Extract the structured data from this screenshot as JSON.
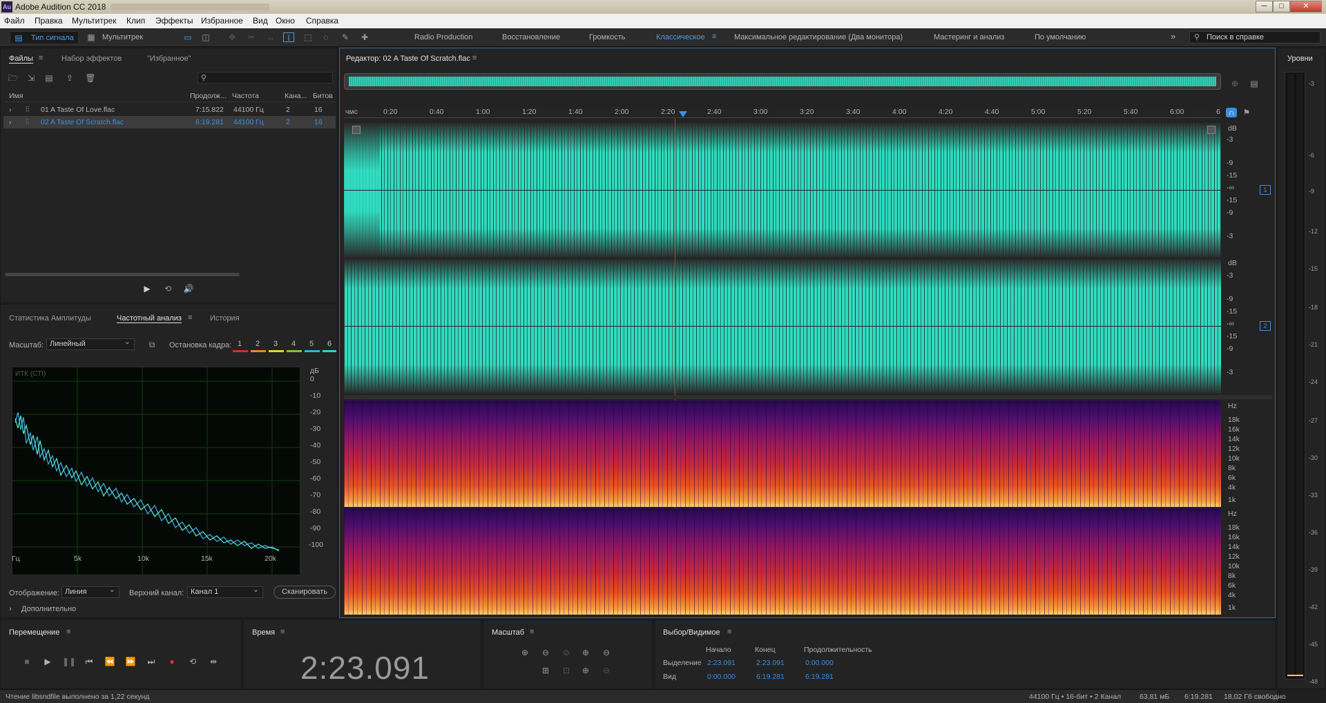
{
  "titlebar": {
    "app_icon": "Au",
    "title": "Adobe Audition CC 2018",
    "min": "─",
    "max": "□",
    "close": "✕"
  },
  "menu": [
    "Файл",
    "Правка",
    "Мультитрек",
    "Клип",
    "Эффекты",
    "Избранное",
    "Вид",
    "Окно",
    "Справка"
  ],
  "toolbar": {
    "waveform_mode": "Тип сигнала",
    "multitrack_mode": "Мультитрек",
    "workspaces": [
      "Radio Production",
      "Восстановление",
      "Громкость",
      "Классическое",
      "Максимальное редактирование (Два монитора)",
      "Мастеринг и анализ",
      "По умолчанию"
    ],
    "active_workspace": "Классическое",
    "more": "»",
    "help_placeholder": "Поиск в справке"
  },
  "files_panel": {
    "tabs": [
      "Файлы",
      "Набор эффектов",
      "\"Избранное\""
    ],
    "columns": [
      "Имя",
      "Продолж...",
      "Частота",
      "Кана...",
      "Битов"
    ],
    "search_placeholder": "",
    "rows": [
      {
        "name": "01 A Taste Of Love.flac",
        "duration": "7:15.822",
        "rate": "44100 Гц",
        "channels": "2",
        "bits": "16"
      },
      {
        "name": "02 A Taste Of Scratch.flac",
        "duration": "6:19.281",
        "rate": "44100 Гц",
        "channels": "2",
        "bits": "16"
      }
    ]
  },
  "analysis_panel": {
    "tabs": [
      "Статистика Амплитуды",
      "Частотный анализ",
      "История"
    ],
    "scale_label": "Масштаб:",
    "scale_value": "Линейный",
    "freeze_label": "Остановка кадра:",
    "freeze_buttons": [
      "1",
      "2",
      "3",
      "4",
      "5",
      "6"
    ],
    "freeze_colors": [
      "#d0312d",
      "#e8882a",
      "#e6d32a",
      "#7dc63a",
      "#3ab0e0",
      "#2ad0d0"
    ],
    "graph_label": "ИТК (СТI)",
    "db_unit": "дБ",
    "db_ticks": [
      "0",
      "-10",
      "-20",
      "-30",
      "-40",
      "-50",
      "-60",
      "-70",
      "-80",
      "-90",
      "-100"
    ],
    "freq_ticks": [
      "Гц",
      "5k",
      "10k",
      "15k",
      "20k"
    ],
    "display_label": "Отображение:",
    "display_value": "Линия",
    "channel_label": "Верхний канал:",
    "channel_value": "Канал 1",
    "scan_button": "Сканировать",
    "more": "Дополнительно"
  },
  "editor": {
    "tab": "Редактор: 02 A Taste Of Scratch.flac",
    "ruler_unit": "чмс",
    "ruler": [
      "0:20",
      "0:40",
      "1:00",
      "1:20",
      "1:40",
      "2:00",
      "2:20",
      "2:40",
      "3:00",
      "3:20",
      "3:40",
      "4:00",
      "4:20",
      "4:40",
      "5:00",
      "5:20",
      "5:40",
      "6:00",
      "6"
    ],
    "db_label": "dB",
    "db_scale": [
      "-3",
      "-9",
      "-15",
      "-∞",
      "-15",
      "-9",
      "-3"
    ],
    "channel_badges": [
      "1",
      "2"
    ],
    "hz_label": "Hz",
    "hz_scale": [
      "18k",
      "16k",
      "14k",
      "12k",
      "10k",
      "8k",
      "6k",
      "4k",
      "1k"
    ],
    "wave_color": "#2fdcc0"
  },
  "levels": {
    "title": "Уровни",
    "ticks": [
      "-3",
      "-6",
      "-9",
      "-12",
      "-15",
      "-18",
      "-21",
      "-24",
      "-27",
      "-30",
      "-33",
      "-36",
      "-39",
      "-42",
      "-45",
      "-48"
    ]
  },
  "transport": {
    "title": "Перемещение",
    "buttons": [
      "stop",
      "play",
      "pause",
      "go-to-start",
      "rewind",
      "fast-forward",
      "go-to-end",
      "record",
      "loop",
      "skip"
    ]
  },
  "time": {
    "title": "Время",
    "value": "2:23.091"
  },
  "zoom": {
    "title": "Масштаб"
  },
  "selection": {
    "title": "Выбор/Видимое",
    "col_start": "Начало",
    "col_end": "Конец",
    "col_duration": "Продолжительность",
    "row_selection": "Выделение",
    "row_view": "Вид",
    "sel_start": "2:23.091",
    "sel_end": "2:23.091",
    "sel_duration": "0:00.000",
    "view_start": "0:00.000",
    "view_end": "6:19.281",
    "view_duration": "6:19.281"
  },
  "statusbar": {
    "left": "Чтение libsndfile выполнено за 1,22 секунд",
    "format": "44100 Гц • 16-бит • 2 Канал",
    "size": "63,81 мБ",
    "duration": "6:19.281",
    "free": "18,02 Гб свободно"
  }
}
